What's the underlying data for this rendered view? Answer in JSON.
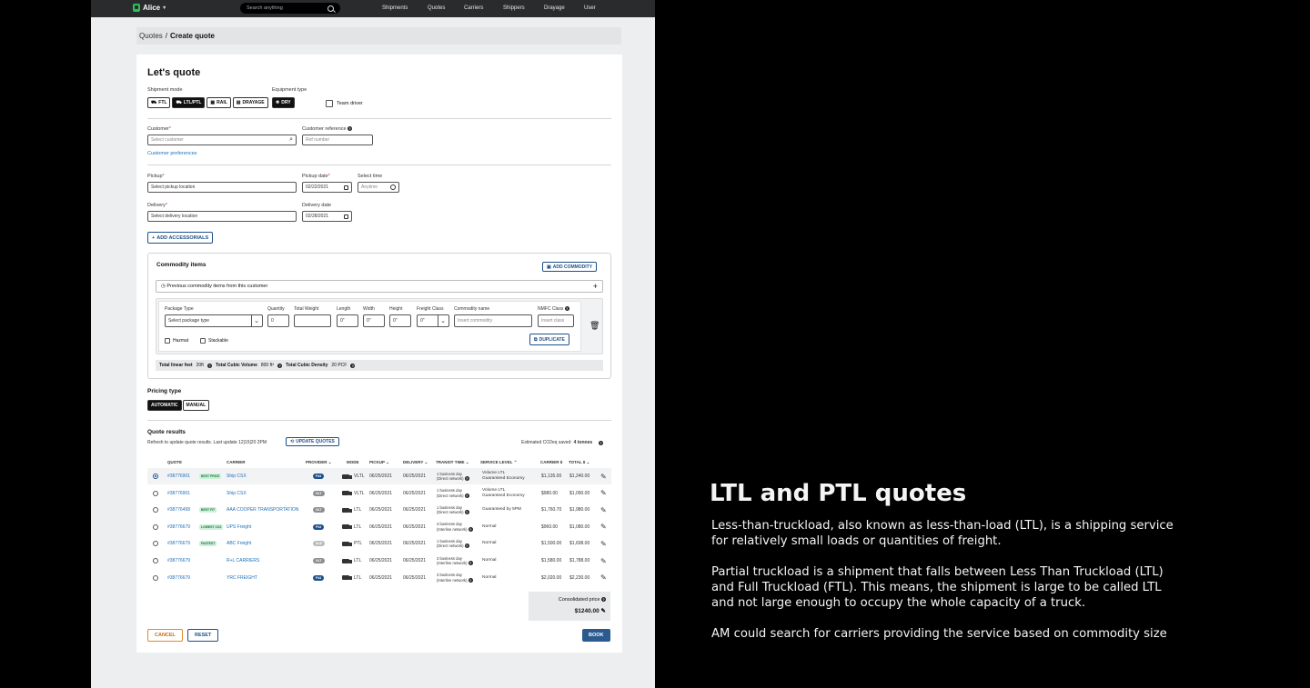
{
  "app": {
    "name": "Alice"
  },
  "search": {
    "placeholder": "Search anything"
  },
  "nav": [
    "Shipments",
    "Quotes",
    "Carriers",
    "Shippers",
    "Drayage",
    "User"
  ],
  "breadcrumb": {
    "parent": "Quotes",
    "sep": "/",
    "current": "Create quote"
  },
  "form": {
    "title": "Let's quote",
    "shipment_mode_label": "Shipment mode",
    "modes": [
      "FTL",
      "LTL/PTL",
      "RAIL",
      "DRAYAGE"
    ],
    "active_mode": "LTL/PTL",
    "equipment_label": "Equipment type",
    "equipment": "DRY",
    "team_driver": "Team driver",
    "customer_label": "Customer",
    "customer_placeholder": "Select customer",
    "customer_ref_label": "Customer reference",
    "customer_ref_placeholder": "Ref number",
    "customer_prefs": "Customer preferences",
    "pickup_label": "Pickup",
    "pickup_value": "Select pickup location",
    "pickup_date_label": "Pickup date",
    "pickup_date": "02/22/2021",
    "select_time_label": "Select time",
    "select_time_placeholder": "Anytime",
    "delivery_label": "Delivery",
    "delivery_value": "Select delivery location",
    "delivery_date_label": "Delivery date",
    "delivery_date": "02/28/2021",
    "add_accessorials": "ADD ACCESSORIALS"
  },
  "commodity": {
    "title": "Commodity items",
    "add_button": "ADD COMMODITY",
    "previous": "Previous commodity items from this customer",
    "headers": {
      "package": "Package Type",
      "quantity": "Quantity",
      "weight": "Total Weight",
      "length": "Length",
      "width": "Width",
      "height": "Height",
      "freight": "Freight Class",
      "name": "Commodity name",
      "nmfc": "NMFC Class"
    },
    "values": {
      "package": "Select package type",
      "quantity": "0",
      "weight": "",
      "length": "0\"",
      "width": "0\"",
      "height": "0\"",
      "freight": "0\"",
      "name_placeholder": "Insert commodity",
      "nmfc_placeholder": "Insert class"
    },
    "hazmat": "Hazmat",
    "stackable": "Stackable",
    "duplicate": "DUPLICATE",
    "totals": {
      "linear_label": "Total linear feet",
      "linear_value": "20ft",
      "volume_label": "Total Cubic Volume",
      "volume_value": "800 ft³",
      "density_label": "Total Cubic Density",
      "density_value": "20 PCF"
    }
  },
  "pricing": {
    "label": "Pricing type",
    "options": [
      "AUTOMATIC",
      "MANUAL"
    ]
  },
  "quotes": {
    "title": "Quote results",
    "refresh_text": "Refresh to update quote results. Last update 12|15|20 2PM",
    "update_button": "UPDATE QUOTES",
    "co2_label": "Estimated CO2eq saved:",
    "co2_value": "4 tonnes",
    "headers": [
      "QUOTE",
      "CARRIER",
      "PROVIDER",
      "MODE",
      "PICKUP",
      "DELIVERY",
      "TRANSIT TIME",
      "SERVICE LEVEL",
      "CARRIER $",
      "TOTAL $"
    ],
    "rows": [
      {
        "quote": "#38776901",
        "badge": "BEST PRICE",
        "carrier": "Ship CSX",
        "provider": "P44",
        "mode": "VLTL",
        "pickup": "06/25/2021",
        "delivery": "06/25/2021",
        "transit1": "1 business day",
        "transit2": "(Direct network)",
        "service1": "Volume LTL",
        "service2": "Guaranteed Economy",
        "carrier_price": "$1,135.00",
        "total": "$1,240.00"
      },
      {
        "quote": "#38776901",
        "badge": "",
        "carrier": "Ship CSX",
        "provider": "GLT",
        "mode": "VLTL",
        "pickup": "06/25/2021",
        "delivery": "06/25/2021",
        "transit1": "1 business day",
        "transit2": "(Direct network)",
        "service1": "Volume LTL",
        "service2": "Guaranteed Economy",
        "carrier_price": "$980.00",
        "total": "$1,090.00"
      },
      {
        "quote": "#38776458",
        "badge": "BEST FIT",
        "carrier": "AAA COOPER TRANSPORTATION",
        "provider": "GLT",
        "mode": "LTL",
        "pickup": "06/25/2021",
        "delivery": "06/25/2021",
        "transit1": "1 business day",
        "transit2": "(Direct network)",
        "service1": "Guaranteed by 5PM",
        "service2": "",
        "carrier_price": "$1,760.70",
        "total": "$1,980.00"
      },
      {
        "quote": "#38776679",
        "badge": "LOWEST CO2",
        "carrier": "UPS Freight",
        "provider": "P44",
        "mode": "LTL",
        "pickup": "06/25/2021",
        "delivery": "06/25/2021",
        "transit1": "3 business day",
        "transit2": "(Interline network)",
        "service1": "Normal",
        "service2": "",
        "carrier_price": "$960.00",
        "total": "$1,080.00"
      },
      {
        "quote": "#38776679",
        "badge": "FASTEST",
        "carrier": "ABC Freight",
        "provider": "SUS",
        "mode": "PTL",
        "pickup": "06/25/2021",
        "delivery": "06/25/2021",
        "transit1": "1 business day",
        "transit2": "(Direct network)",
        "service1": "Normal",
        "service2": "",
        "carrier_price": "$1,500.00",
        "total": "$1,698.00"
      },
      {
        "quote": "#38776679",
        "badge": "",
        "carrier": "R+L CARRIERS",
        "provider": "GLT",
        "mode": "LTL",
        "pickup": "06/25/2021",
        "delivery": "06/25/2021",
        "transit1": "3 business day",
        "transit2": "(Interline network)",
        "service1": "Normal",
        "service2": "",
        "carrier_price": "$1,580.00",
        "total": "$1,788.00"
      },
      {
        "quote": "#38776679",
        "badge": "",
        "carrier": "YRC FREIGHT",
        "provider": "P44",
        "mode": "LTL",
        "pickup": "06/25/2021",
        "delivery": "06/25/2021",
        "transit1": "3 business day",
        "transit2": "(Interline network)",
        "service1": "Normal",
        "service2": "",
        "carrier_price": "$2,020.00",
        "total": "$2,230.00"
      }
    ],
    "consolidated_label": "Consolidated price",
    "consolidated_value": "$1240.00"
  },
  "actions": {
    "cancel": "CANCEL",
    "reset": "RESET",
    "book": "BOOK"
  },
  "provider_colors": {
    "P44": "#1f4f8a",
    "GLT": "#8a8f96",
    "SUS": "#b8bcc2"
  },
  "side_panel": {
    "title": "LTL and PTL quotes",
    "paragraphs": [
      "Less-than-truckload, also known as less-than-load (LTL), is a shipping service for relatively small loads or quantities of freight.",
      "Partial truckload is a shipment that falls between Less Than Truckload (LTL) and Full Truckload (FTL). This means, the shipment is large to be called LTL and not large enough to occupy the whole capacity of a truck.",
      "AM could search for carriers providing the service based on commodity size"
    ]
  }
}
